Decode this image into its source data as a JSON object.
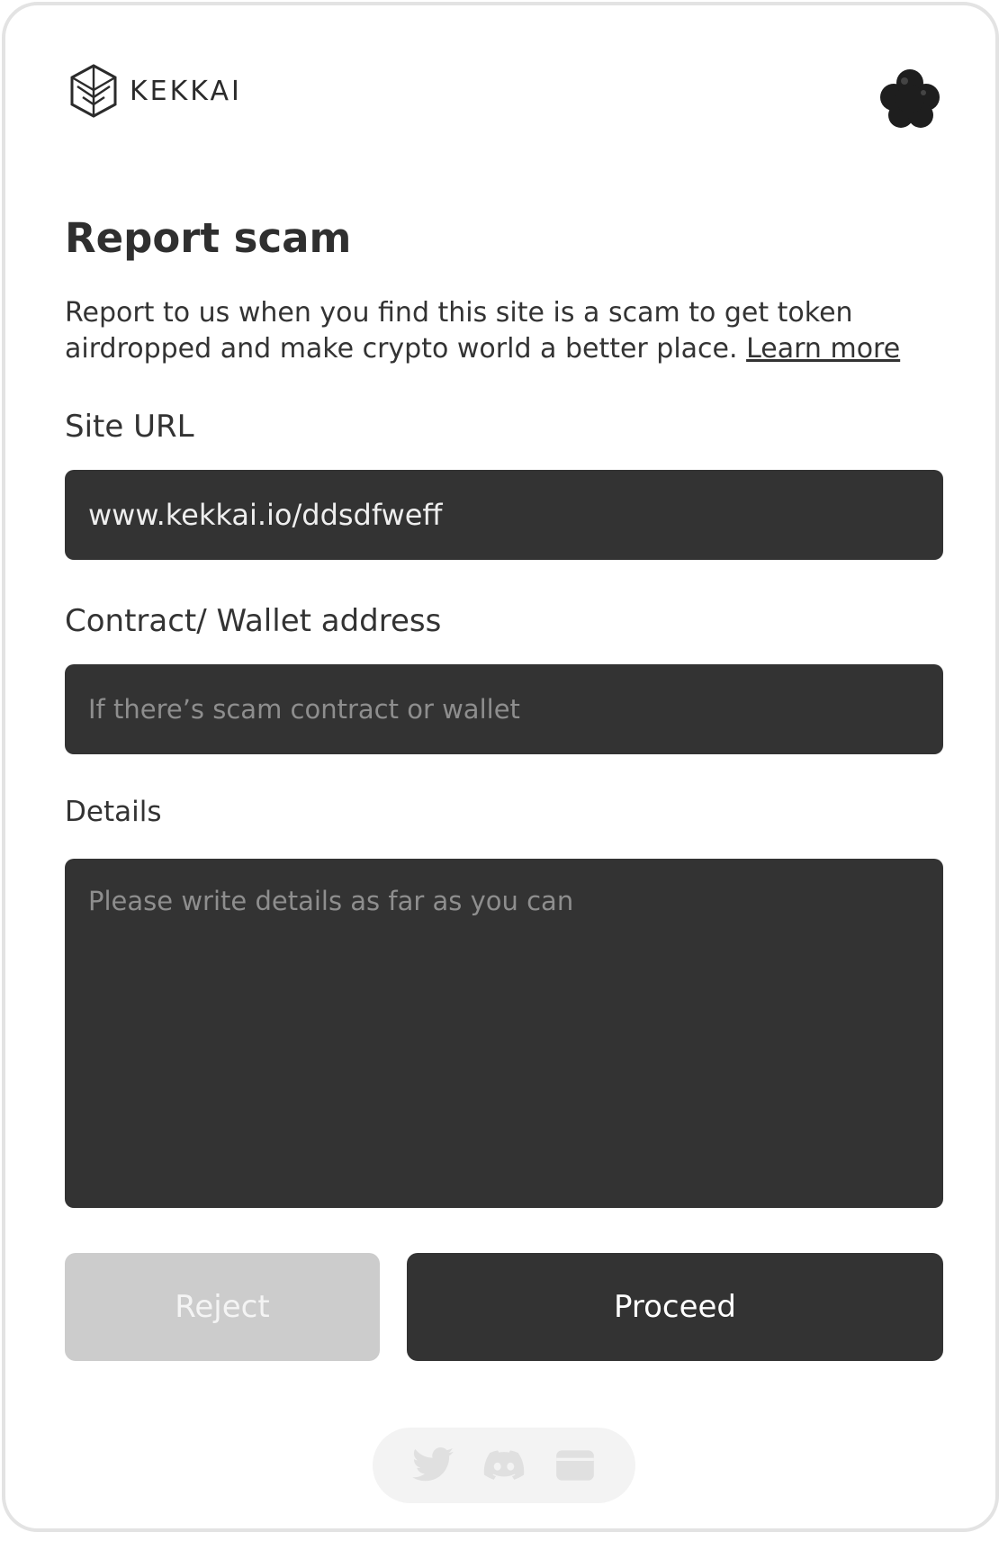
{
  "brand": {
    "name": "KEKKAI"
  },
  "form": {
    "title": "Report scam",
    "description": "Report to us when you find this site is a scam to get token airdropped and make crypto world a better place.",
    "learn_more": "Learn more",
    "site_url": {
      "label": "Site URL",
      "value": "www.kekkai.io/ddsdfweff"
    },
    "wallet": {
      "label": "Contract/ Wallet address",
      "placeholder": "If there’s scam contract or wallet"
    },
    "details": {
      "label": "Details",
      "placeholder": "Please write details as far as you can"
    }
  },
  "actions": {
    "reject_label": "Reject",
    "proceed_label": "Proceed"
  },
  "social": {
    "icons": [
      "twitter-icon",
      "discord-icon",
      "browser-icon"
    ]
  },
  "colors": {
    "primary": "#333333",
    "disabled": "#cccccc",
    "text": "#333333"
  }
}
